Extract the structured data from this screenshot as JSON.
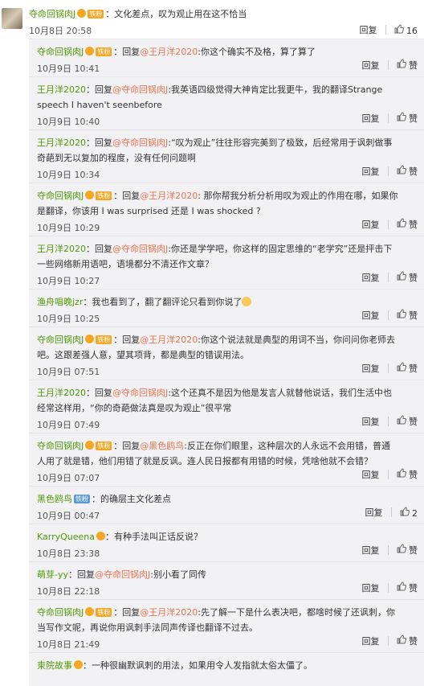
{
  "main_comment": {
    "user": "夺命回锅肉J",
    "badge": "铁粉",
    "text": "：文化差点，叹为观止用在这不恰当",
    "time": "10月8日 20:58",
    "reply_label": "回复",
    "like_count": "16"
  },
  "replies": [
    {
      "user": "夺命回锅肉J",
      "badge": "铁粉",
      "pre": "：回复",
      "mention": "@王月洋2020",
      "text": ":你这个确实不及格，算了算了",
      "time": "10月9日 10:41",
      "reply_label": "回复",
      "like": "赞"
    },
    {
      "user": "王月洋2020",
      "badge": "",
      "pre": "：回复",
      "mention": "@夺命回锅肉J",
      "text": ":我英语四级觉得大神肯定比我更牛，我的翻译Strange speech I haven't seenbefore",
      "time": "10月9日 10:40",
      "reply_label": "回复",
      "like": "赞"
    },
    {
      "user": "王月洋2020",
      "badge": "",
      "pre": "：回复",
      "mention": "@夺命回锅肉J",
      "text": ":“叹为观止”往往形容完美到了极致，后经常用于讽刺做事奇葩到无以复加的程度，没有任何问题啊",
      "time": "10月9日 10:34",
      "reply_label": "回复",
      "like": "赞"
    },
    {
      "user": "夺命回锅肉J",
      "badge": "铁粉",
      "pre": "：回复",
      "mention": "@王月洋2020",
      "text": ": 那你帮我分析分析用叹为观止的作用在哪，如果你是翻译，你该用 I was surprised 还是 I was shocked ?",
      "time": "10月9日 10:29",
      "reply_label": "回复",
      "like": "赞"
    },
    {
      "user": "王月洋2020",
      "badge": "",
      "pre": "：回复",
      "mention": "@夺命回锅肉J",
      "text": ":你还是学学吧，你这样的固定思维的“老学究”还是抨击下一些网络新用语吧，语境都分不清还作文章？",
      "time": "10月9日 10:27",
      "reply_label": "回复",
      "like": "赞"
    },
    {
      "user": "渔舟唱晚jzr",
      "badge": "",
      "pre": "：我也看到了，翻了翻评论只看到你说了",
      "mention": "",
      "text": "",
      "time": "10月9日 10:25",
      "reply_label": "回复",
      "like": "赞"
    },
    {
      "user": "夺命回锅肉J",
      "badge": "铁粉",
      "pre": "：回复",
      "mention": "@王月洋2020",
      "text": ":你这个说法就是典型的用词不当，你问问你老师去吧。这跟差强人意，望其项背，都是典型的错误用法。",
      "time": "10月9日 07:51",
      "reply_label": "回复",
      "like": "赞"
    },
    {
      "user": "王月洋2020",
      "badge": "",
      "pre": "：回复",
      "mention": "@夺命回锅肉J",
      "text": ":这个还真不是因为他是发言人就替他说话，我们生活中也经常这样用，“你的奇葩做法真是叹为观止”很平常",
      "time": "10月9日 07:49",
      "reply_label": "回复",
      "like": "赞"
    },
    {
      "user": "夺命回锅肉J",
      "badge": "铁粉",
      "pre": "：回复",
      "mention": "@黑色鸥鸟",
      "text": ":反正在你们眼里，这种层次的人永远不会用错，普通人用了就是错，他们用错了就是反讽。连人民日报都有用错的时候，凭啥他就不会错？",
      "time": "10月9日 07:07",
      "reply_label": "回复",
      "like": "赞"
    },
    {
      "user": "黑色鸥鸟",
      "badge": "铁粉",
      "pre": "：的确层主文化差点",
      "mention": "",
      "text": "",
      "time": "10月9日 00:47",
      "reply_label": "回复",
      "like": "2"
    },
    {
      "user": "KarryQueena",
      "badge": "",
      "pre": "：有种手法叫正话反说？",
      "mention": "",
      "text": "",
      "time": "10月8日 23:38",
      "reply_label": "回复",
      "like": "赞"
    },
    {
      "user": "萌芽-yy",
      "badge": "",
      "pre": "：回复",
      "mention": "@夺命回锅肉J",
      "text": ":别小看了同传",
      "time": "10月8日 22:18",
      "reply_label": "回复",
      "like": "赞"
    },
    {
      "user": "夺命回锅肉J",
      "badge": "铁粉",
      "pre": "：回复",
      "mention": "@王月洋2020",
      "text": ":先了解一下是什么表决吧，都啥时候了还讽刺，你当写作文呢，再说你用讽刺手法同声传译也翻译不过去。",
      "time": "10月8日 21:49",
      "reply_label": "回复",
      "like": "赞"
    },
    {
      "user": "柬院故事",
      "badge": "",
      "pre": "：一种很幽默讽刺的用法，如果用令人发指就太俗太僵了。",
      "mention": "",
      "text": "",
      "time": "",
      "reply_label": "",
      "like": ""
    }
  ],
  "colors": {
    "accent": "#eb7350",
    "user_green": "#4e9a06",
    "badge": "#f5a623"
  }
}
